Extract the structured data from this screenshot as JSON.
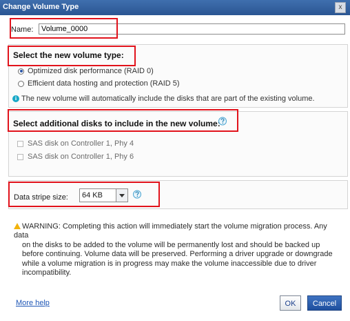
{
  "window": {
    "title": "Change Volume Type",
    "close_glyph": "x"
  },
  "name_field": {
    "label": "Name:",
    "value": "Volume_0000"
  },
  "volume_type": {
    "heading": "Select the new volume type:",
    "options": [
      {
        "label": "Optimized disk performance (RAID 0)",
        "selected": true
      },
      {
        "label": "Efficient data hosting and protection (RAID 5)",
        "selected": false
      }
    ],
    "info": "The new volume will automatically include the disks that are part of the existing volume."
  },
  "additional_disks": {
    "heading": "Select additional disks to include in the new volume:",
    "disks": [
      {
        "label": "SAS disk on Controller 1, Phy 4",
        "checked": false
      },
      {
        "label": "SAS disk on Controller 1, Phy 6",
        "checked": false
      }
    ]
  },
  "stripe": {
    "label": "Data stripe size:",
    "value": "64 KB"
  },
  "warning": {
    "lines": [
      "WARNING: Completing this action will immediately start the volume migration process. Any data",
      "on the disks to be added to the volume will be permanently lost and should be backed up",
      "before continuing. Volume data will be preserved. Performing a driver upgrade or downgrade",
      "while a volume migration is in progress may make the volume inaccessible due to driver",
      "incompatibility."
    ]
  },
  "footer": {
    "more_help": "More help",
    "ok": "OK",
    "cancel": "Cancel"
  },
  "colors": {
    "title_bar": "#2f5f9f",
    "highlight_box": "#e1121b",
    "cancel_button": "#2b5eb0",
    "link": "#1e56b6"
  },
  "icons": {
    "info": "info-icon",
    "help": "question-bubble-icon",
    "warning": "warning-triangle-icon",
    "close": "close-icon"
  }
}
